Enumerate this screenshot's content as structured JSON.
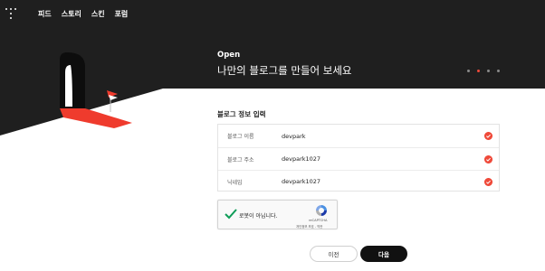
{
  "nav": {
    "items": [
      {
        "label": "피드"
      },
      {
        "label": "스토리"
      },
      {
        "label": "스킨"
      },
      {
        "label": "포럼"
      }
    ]
  },
  "hero": {
    "label": "Open",
    "title": "나만의 블로그를 만들어 보세요",
    "slides": 4,
    "active_slide": 2
  },
  "form": {
    "section_title": "블로그 정보 입력",
    "rows": [
      {
        "label": "블로그 이름",
        "value": "devpark",
        "status_icon": "check-icon"
      },
      {
        "label": "블로그 주소",
        "value": "devpark1027",
        "status_icon": "check-icon"
      },
      {
        "label": "닉네임",
        "value": "devpark1027",
        "status_icon": "check-icon"
      }
    ]
  },
  "captcha": {
    "label": "로봇이 아닙니다.",
    "brand": "reCAPTCHA",
    "links": "개인정보 보호 - 약관",
    "checked": true
  },
  "buttons": {
    "prev": "이전",
    "next": "다음"
  },
  "colors": {
    "hero_bg": "#1f1f1f",
    "accent": "#ef4a3a",
    "check_green": "#0f9d58",
    "primary_button": "#111111"
  }
}
